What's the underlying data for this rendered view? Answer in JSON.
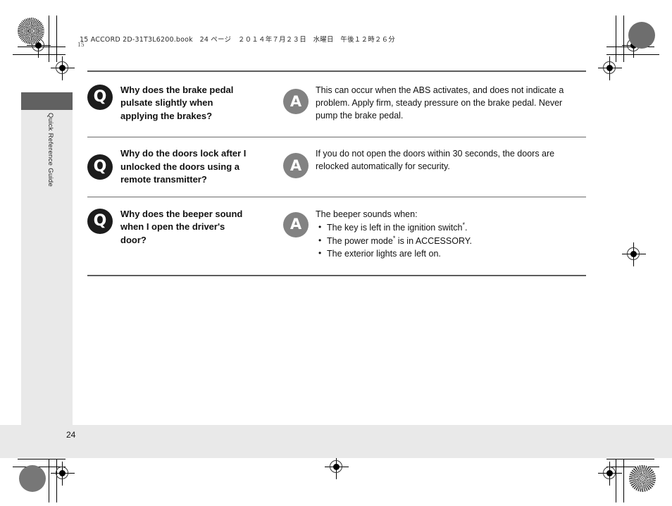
{
  "document": {
    "running_header": "15 ACCORD 2D-31T3L6200.book　24 ページ　２０１４年７月２３日　水曜日　午後１２時２６分",
    "page_number": "24",
    "side_tab_label": "Quick Reference Guide",
    "prepress_label": "15"
  },
  "faq": {
    "items": [
      {
        "q_badge": "Q",
        "a_badge": "A",
        "question": "Why does the brake pedal pulsate slightly when applying the brakes?",
        "answer": "This can occur when the ABS activates, and does not indicate a problem. Apply firm, steady pressure on the brake pedal. Never pump the brake pedal.",
        "bullets": []
      },
      {
        "q_badge": "Q",
        "a_badge": "A",
        "question": "Why do the doors lock after I unlocked the doors using a remote transmitter?",
        "answer": "If you do not open the doors within 30 seconds, the doors are relocked automatically for security.",
        "bullets": []
      },
      {
        "q_badge": "Q",
        "a_badge": "A",
        "question": "Why does the beeper sound when I open the driver's door?",
        "answer": "The beeper sounds when:",
        "bullets": [
          {
            "text_before": "The key is left in the ignition switch",
            "asterisk": "*",
            "text_after": "."
          },
          {
            "text_before": "The power mode",
            "asterisk": "*",
            "text_after": " is in ACCESSORY."
          },
          {
            "text_before": "The exterior lights are left on.",
            "asterisk": "",
            "text_after": ""
          }
        ]
      }
    ]
  },
  "colors": {
    "q_badge_bg": "#1c1c1c",
    "a_badge_bg": "#828282",
    "rule": "#5d5d5d",
    "side_tab": "#616161",
    "side_strip": "#e9e9e9",
    "footer_band": "#e9e9e9"
  }
}
